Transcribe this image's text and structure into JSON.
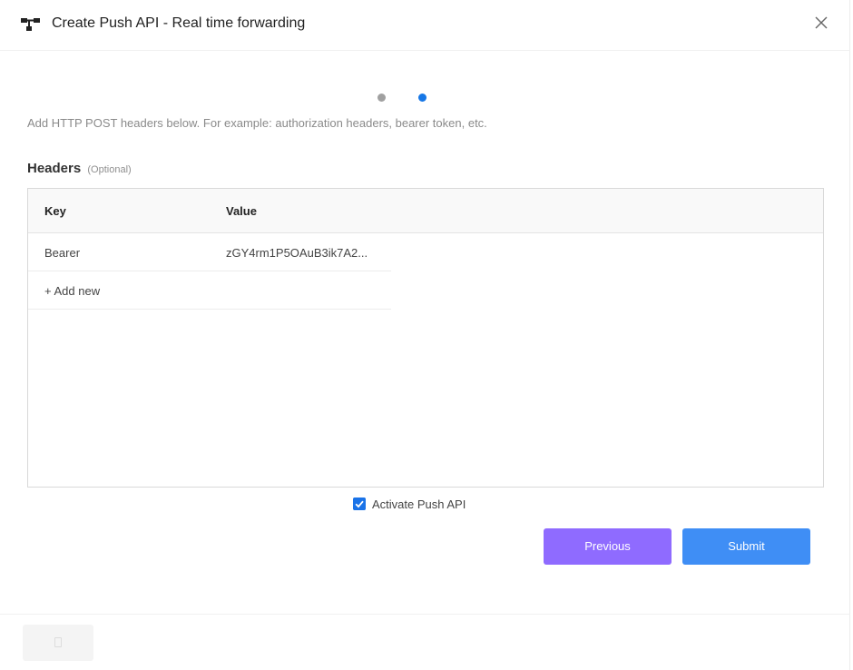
{
  "header": {
    "title": "Create Push API - Real time forwarding",
    "logo_icon": "hierarchy-icon",
    "close_icon": "close-icon"
  },
  "steps": {
    "count": 2,
    "active": 2
  },
  "hint": "Add HTTP POST headers below. For example: authorization headers, bearer token, etc.",
  "headers_section": {
    "title": "Headers",
    "optional": "(Optional)",
    "columns": [
      "Key",
      "Value"
    ],
    "rows": [
      {
        "key": "Bearer",
        "value": "zGY4rm1P5OAuB3ik7A2..."
      }
    ],
    "add_new": "+ Add new"
  },
  "activate": {
    "label": "Activate Push API",
    "checked": true
  },
  "buttons": {
    "previous": "Previous",
    "submit": "Submit"
  },
  "colors": {
    "previous": "#8f6bff",
    "submit": "#3f8ef5",
    "step_active": "#1677e6",
    "step_inactive": "#a0a0a0",
    "checkbox": "#1a73e8"
  }
}
